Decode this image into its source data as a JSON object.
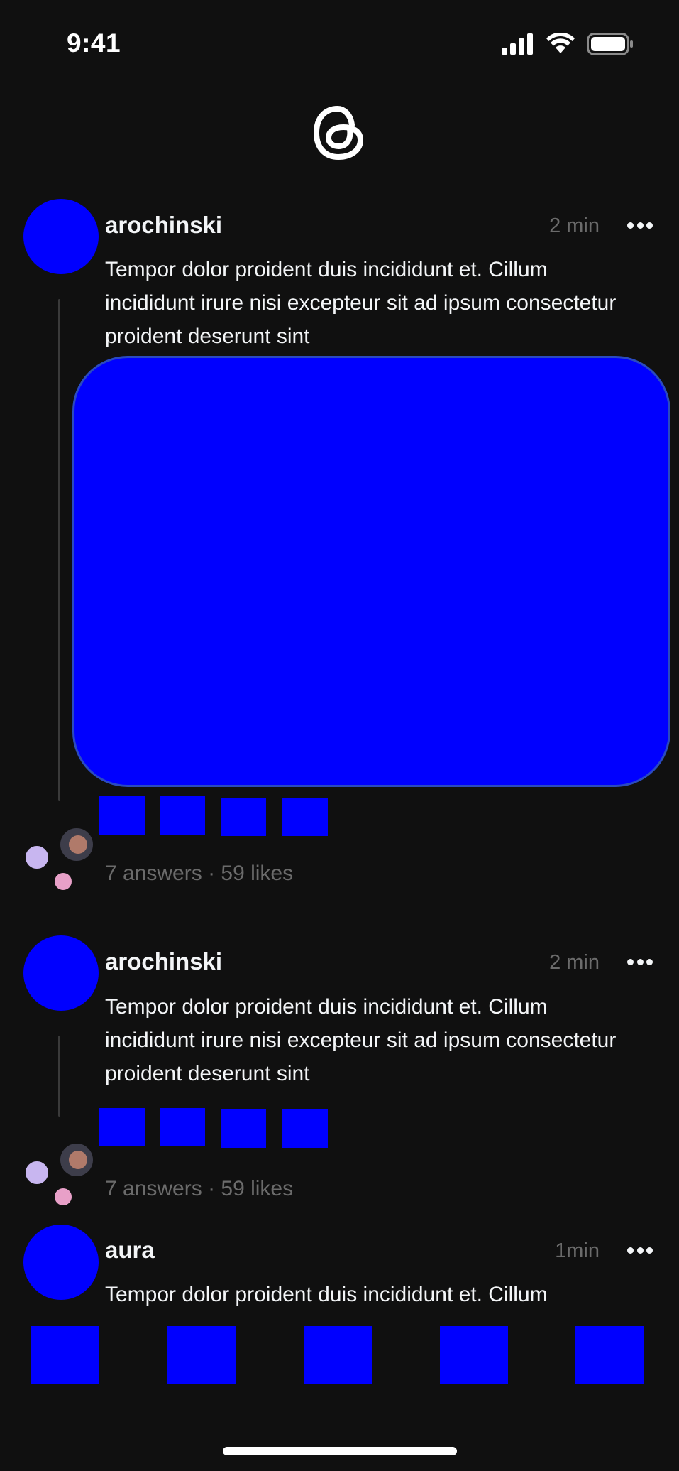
{
  "status_bar": {
    "time": "9:41"
  },
  "posts": [
    {
      "username": "arochinski",
      "time": "2 min",
      "text": "Tempor dolor proident duis incididunt et. Cillum incididunt irure nisi excepteur sit ad ipsum consectetur proident deserunt sint",
      "stats": "7 answers · 59 likes"
    },
    {
      "username": "arochinski",
      "time": "2 min",
      "text": "Tempor dolor proident duis incididunt et. Cillum incididunt irure nisi excepteur sit ad ipsum consectetur proident deserunt sint",
      "stats": "7 answers · 59 likes"
    },
    {
      "username": "aura",
      "time": "1min",
      "text": "Tempor dolor proident duis incididunt et. Cillum"
    }
  ],
  "post_actions": [
    "like-icon",
    "comment-icon",
    "repost-icon",
    "share-icon"
  ],
  "tab_bar": [
    "home-icon",
    "search-icon",
    "new-thread-icon",
    "activity-icon",
    "profile-icon"
  ],
  "colors": {
    "background": "#101010",
    "placeholder": "#0000ff",
    "secondary_text": "#6b6b6b"
  }
}
